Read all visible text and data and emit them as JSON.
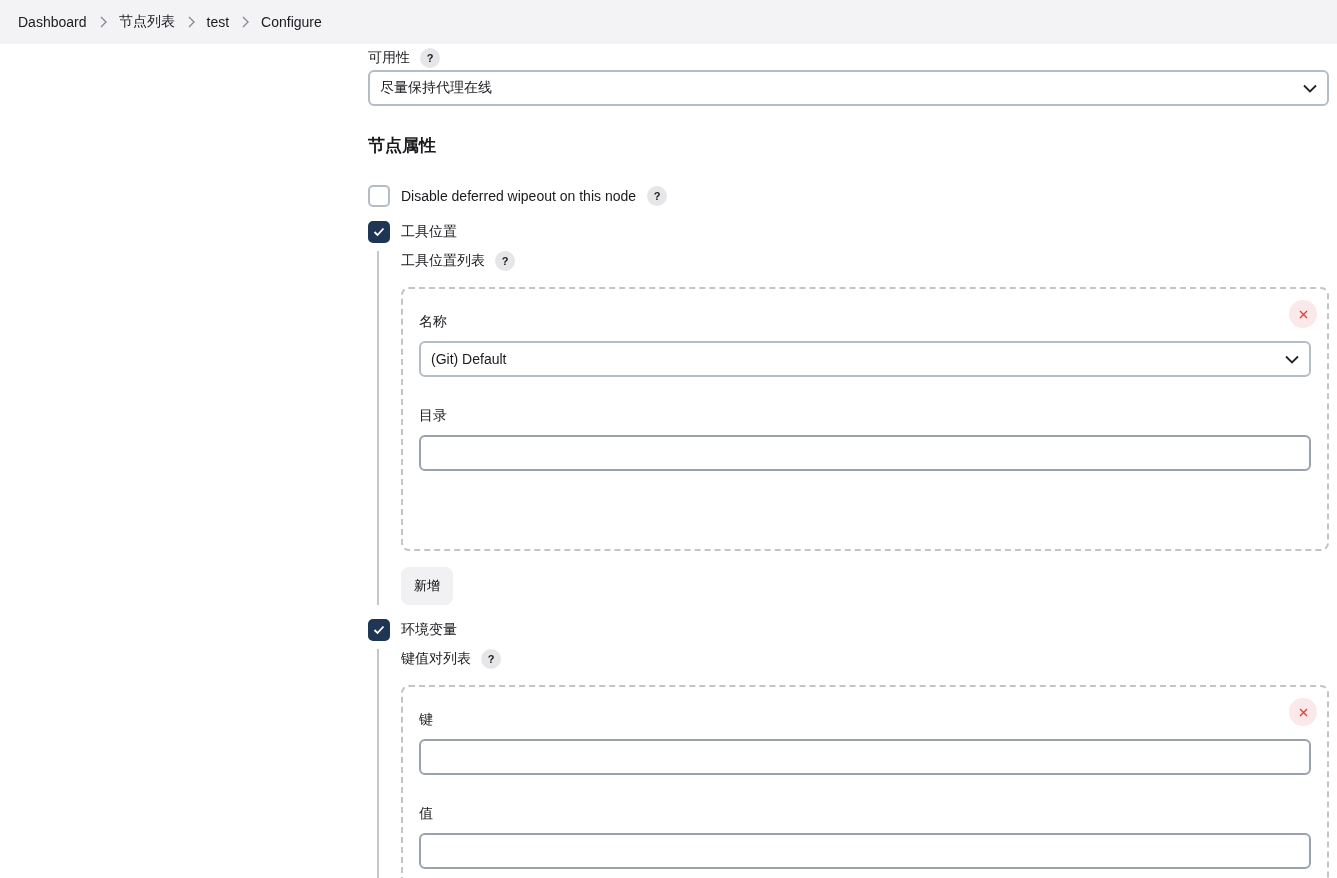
{
  "breadcrumbs": [
    "Dashboard",
    "节点列表",
    "test",
    "Configure"
  ],
  "availability": {
    "label": "可用性",
    "help": "?",
    "value": "尽量保持代理在线"
  },
  "section_title": "节点属性",
  "properties": [
    {
      "kind": "checkbox",
      "label": "Disable deferred wipeout on this node",
      "checked": false,
      "help": "?"
    },
    {
      "kind": "checkbox",
      "label": "工具位置",
      "checked": true,
      "list": {
        "label": "工具位置列表",
        "help": "?",
        "add_button": "新增",
        "entries": [
          {
            "fields": [
              {
                "kind": "select",
                "label": "名称",
                "value": "(Git) Default"
              },
              {
                "kind": "text",
                "label": "目录"
              }
            ]
          }
        ]
      }
    },
    {
      "kind": "checkbox",
      "label": "环境变量",
      "checked": true,
      "list": {
        "label": "键值对列表",
        "help": "?",
        "entries": [
          {
            "fields": [
              {
                "kind": "text",
                "label": "键"
              },
              {
                "kind": "text",
                "label": "值"
              }
            ]
          }
        ]
      }
    }
  ]
}
